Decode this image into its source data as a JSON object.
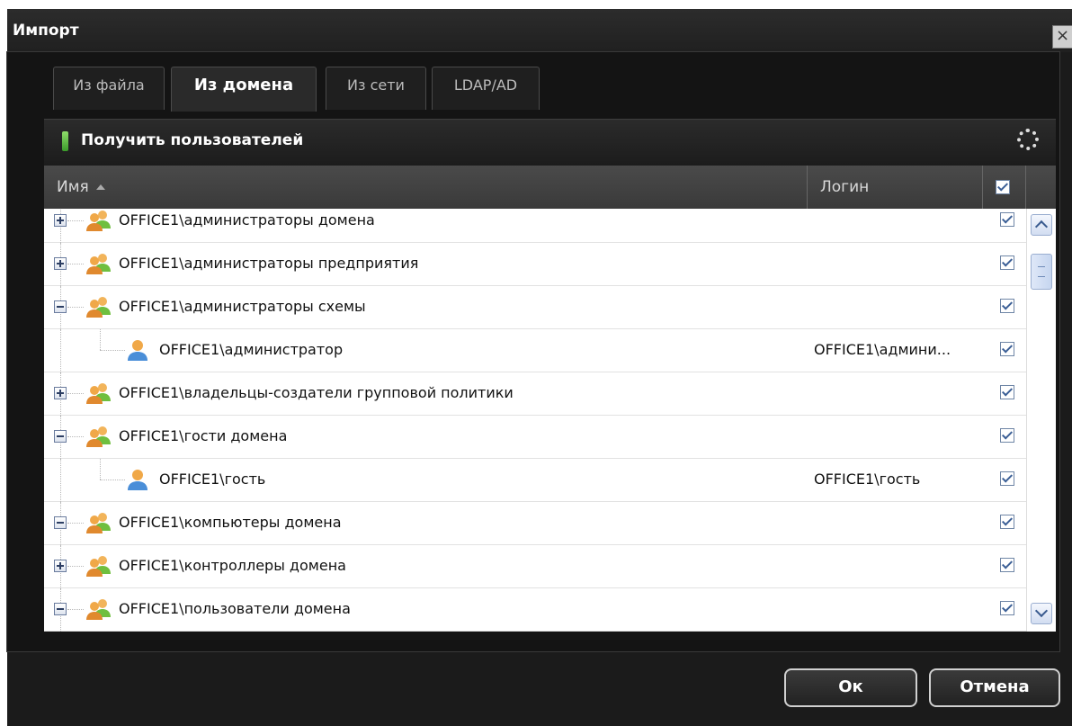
{
  "window": {
    "title": "Импорт"
  },
  "tabs": [
    {
      "label": "Из файла",
      "active": false
    },
    {
      "label": "Из домена",
      "active": true
    },
    {
      "label": "Из сети",
      "active": false
    },
    {
      "label": "LDAP/AD",
      "active": false
    }
  ],
  "toolbar": {
    "get_users_label": "Получить пользователей"
  },
  "table": {
    "columns": {
      "name": "Имя",
      "login": "Логин"
    },
    "header_checkbox_checked": true,
    "rows": [
      {
        "type": "group",
        "expanded": false,
        "name": "OFFICE1\\администраторы домена",
        "login": "",
        "checked": true
      },
      {
        "type": "group",
        "expanded": false,
        "name": "OFFICE1\\администраторы предприятия",
        "login": "",
        "checked": true
      },
      {
        "type": "group",
        "expanded": true,
        "name": "OFFICE1\\администраторы схемы",
        "login": "",
        "checked": true
      },
      {
        "type": "user",
        "name": "OFFICE1\\администратор",
        "login": "OFFICE1\\админи...",
        "checked": true
      },
      {
        "type": "group",
        "expanded": false,
        "name": "OFFICE1\\владельцы-создатели групповой политики",
        "login": "",
        "checked": true
      },
      {
        "type": "group",
        "expanded": true,
        "name": "OFFICE1\\гости домена",
        "login": "",
        "checked": true
      },
      {
        "type": "user",
        "name": "OFFICE1\\гость",
        "login": "OFFICE1\\гость",
        "checked": true
      },
      {
        "type": "group",
        "expanded": true,
        "name": "OFFICE1\\компьютеры домена",
        "login": "",
        "checked": true
      },
      {
        "type": "group",
        "expanded": false,
        "name": "OFFICE1\\контроллеры домена",
        "login": "",
        "checked": true
      },
      {
        "type": "group",
        "expanded": true,
        "name": "OFFICE1\\пользователи домена",
        "login": "",
        "checked": true
      }
    ]
  },
  "footer": {
    "ok_label": "Ок",
    "cancel_label": "Отмена"
  },
  "icons": {
    "close": "close-icon",
    "refresh": "spinner-icon",
    "get_users": "download-icon",
    "group": "user-group-icon",
    "user": "user-icon",
    "sort": "sort-ascending-icon"
  },
  "colors": {
    "dialog_bg": "#1b1b1b",
    "header_bg": "#404040",
    "accent_green": "#5fbf3f",
    "checkbox_check": "#3b5f96"
  }
}
